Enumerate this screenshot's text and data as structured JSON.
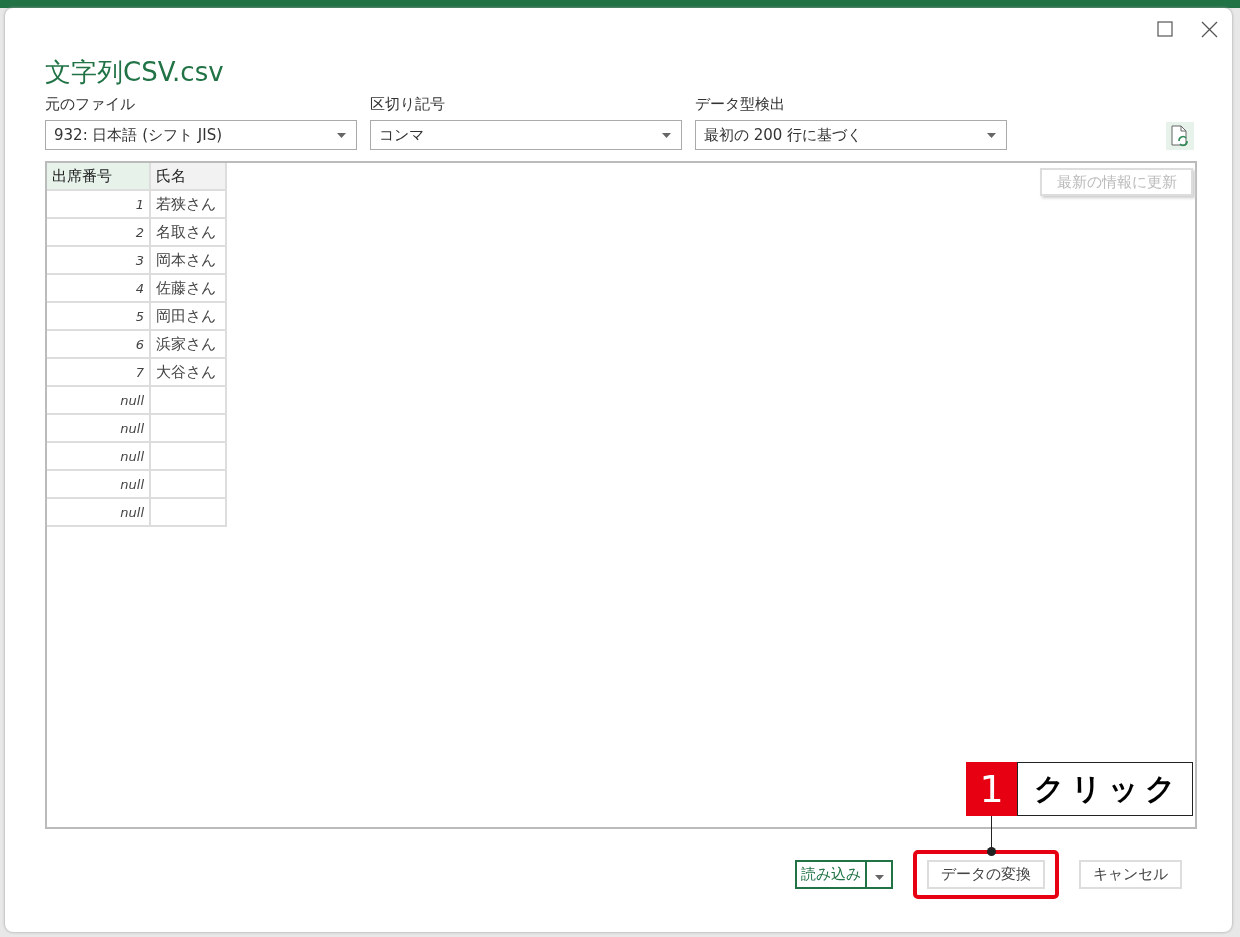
{
  "dialog": {
    "title": "文字列CSV.csv",
    "fields": [
      {
        "label": "元のファイル",
        "value": "932: 日本語 (シフト JIS)"
      },
      {
        "label": "区切り記号",
        "value": "コンマ"
      },
      {
        "label": "データ型検出",
        "value": "最初の 200 行に基づく"
      }
    ],
    "preview": {
      "refresh_button": {
        "label": "最新の情報に更新",
        "disabled": true
      },
      "table": {
        "columns": [
          "出席番号",
          "氏名"
        ],
        "rows": [
          {
            "number": "1",
            "name": "若狭さん"
          },
          {
            "number": "2",
            "name": "名取さん"
          },
          {
            "number": "3",
            "name": "岡本さん"
          },
          {
            "number": "4",
            "name": "佐藤さん"
          },
          {
            "number": "5",
            "name": "岡田さん"
          },
          {
            "number": "6",
            "name": "浜家さん"
          },
          {
            "number": "7",
            "name": "大谷さん"
          },
          {
            "number": "null"
          },
          {
            "number": "null"
          },
          {
            "number": "null"
          },
          {
            "number": "null"
          },
          {
            "number": "null"
          }
        ]
      }
    },
    "buttons": [
      {
        "kind": "split",
        "label": "読み込み",
        "highlighted": false
      },
      {
        "kind": "plain",
        "label": "データの変換",
        "highlighted": true
      },
      {
        "kind": "plain",
        "label": "キャンセル",
        "highlighted": false
      }
    ]
  },
  "callout": {
    "number": "1",
    "text": "クリック"
  }
}
